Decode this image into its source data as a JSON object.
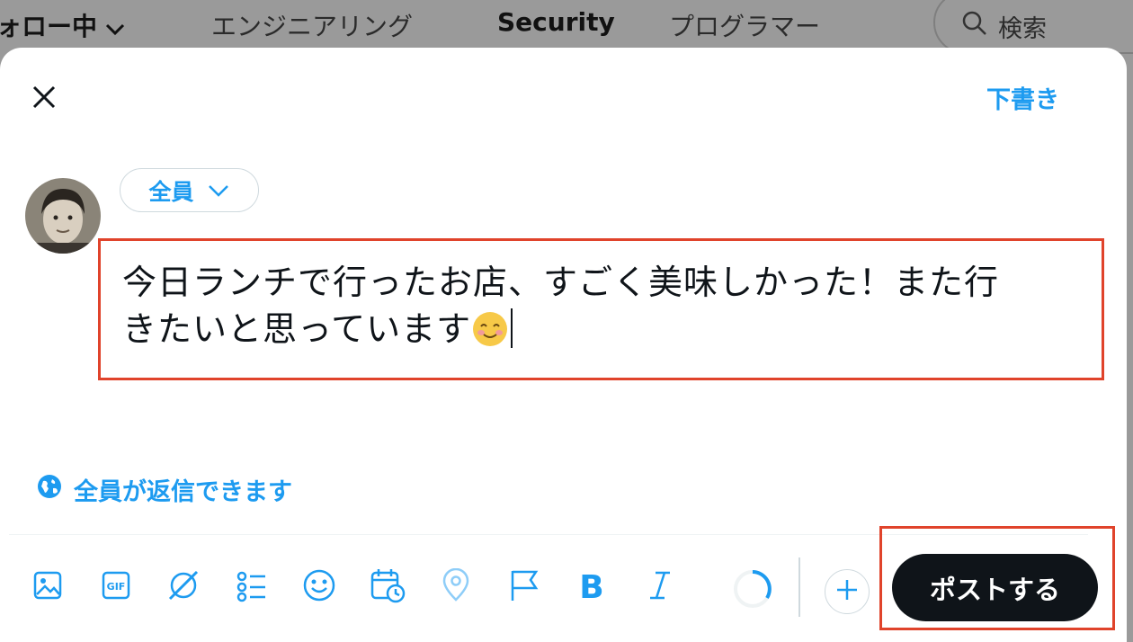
{
  "background_tabs": {
    "following": "ォロー中",
    "engineering": "エンジニアリング",
    "security": "Security",
    "programmer": "プログラマー",
    "search_label": "検索"
  },
  "modal": {
    "drafts_label": "下書き",
    "audience_label": "全員",
    "post_text_line1": "今日ランチで行ったお店、すごく美味しかった！また行",
    "post_text_line2": "きたいと思っています",
    "reply_setting_label": "全員が返信できます",
    "post_button_label": "ポストする"
  },
  "toolbar": {
    "items": [
      "image-icon",
      "gif-icon",
      "grok-icon",
      "poll-icon",
      "emoji-icon",
      "schedule-icon",
      "location-icon",
      "flag-icon",
      "bold-icon",
      "italic-icon"
    ]
  },
  "colors": {
    "accent": "#1d9bf0",
    "post_button": "#0f1419",
    "highlight": "#e0432b",
    "overlay": "#9a9a9a"
  }
}
